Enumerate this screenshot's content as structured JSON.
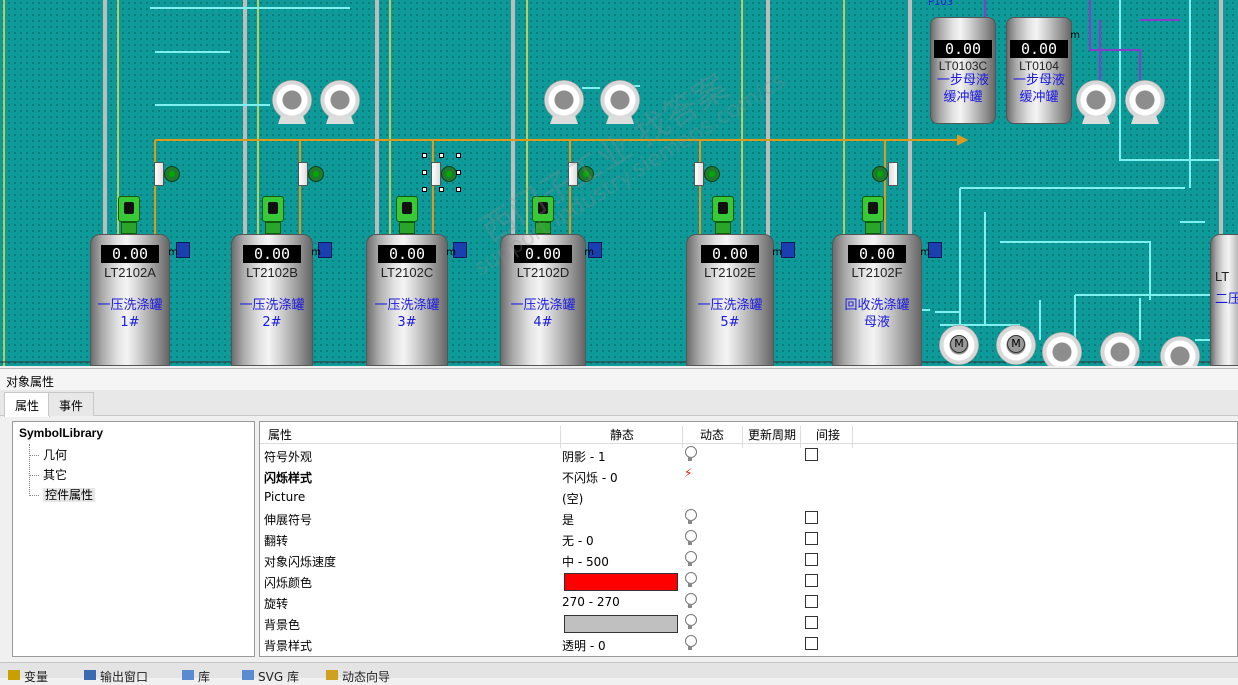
{
  "canvas": {
    "partial_label": "P103",
    "tanks": [
      {
        "value": "0.00",
        "unit": "m",
        "tag": "LT2102A",
        "desc": "一压洗涤罐\n1#"
      },
      {
        "value": "0.00",
        "unit": "m",
        "tag": "LT2102B",
        "desc": "一压洗涤罐\n2#"
      },
      {
        "value": "0.00",
        "unit": "m",
        "tag": "LT2102C",
        "desc": "一压洗涤罐\n3#"
      },
      {
        "value": "0.00",
        "unit": "m",
        "tag": "LT2102D",
        "desc": "一压洗涤罐\n4#"
      },
      {
        "value": "0.00",
        "unit": "m",
        "tag": "LT2102E",
        "desc": "一压洗涤罐\n5#"
      },
      {
        "value": "0.00",
        "unit": "m",
        "tag": "LT2102F",
        "desc": "回收洗涤罐\n母液"
      }
    ],
    "small_tanks": [
      {
        "value": "0.00",
        "unit": "m",
        "tag": "LT0103C",
        "desc": "一步母液\n缓冲罐"
      },
      {
        "value": "0.00",
        "unit": "m",
        "tag": "LT0104",
        "desc": "一步母液\n缓冲罐"
      }
    ],
    "edge_tank": {
      "tag": "LT",
      "desc": "二压"
    },
    "pump_motor_label": "M",
    "watermark": "西门子工业 找答案",
    "watermark_url": "support.industry.siemens.com/cs"
  },
  "panel": {
    "title": "对象属性",
    "tabs": [
      "属性",
      "事件"
    ],
    "tree": {
      "root": "SymbolLibrary",
      "nodes": [
        "几何",
        "其它",
        "控件属性"
      ],
      "selected": "控件属性"
    },
    "grid": {
      "headers": [
        "属性",
        "静态",
        "动态",
        "更新周期",
        "间接"
      ],
      "rows": [
        {
          "name": "符号外观",
          "static": "阴影 - 1",
          "dyn": "bulb",
          "indirect": true,
          "bold": false
        },
        {
          "name": "闪烁样式",
          "static": "不闪烁 - 0",
          "dyn": "bolt",
          "indirect": false,
          "bold": true
        },
        {
          "name": "Picture",
          "static": "(空)",
          "dyn": "",
          "indirect": false,
          "bold": false
        },
        {
          "name": "伸展符号",
          "static": "是",
          "dyn": "bulb",
          "indirect": true,
          "bold": false
        },
        {
          "name": "翻转",
          "static": "无 - 0",
          "dyn": "bulb",
          "indirect": true,
          "bold": false
        },
        {
          "name": "对象闪烁速度",
          "static": "中 - 500",
          "dyn": "bulb",
          "indirect": true,
          "bold": false
        },
        {
          "name": "闪烁颜色",
          "static": "",
          "swatch": "#ff0000",
          "dyn": "bulb",
          "indirect": true,
          "bold": false
        },
        {
          "name": "旋转",
          "static": "270 - 270",
          "dyn": "bulb",
          "indirect": true,
          "bold": false
        },
        {
          "name": "背景色",
          "static": "",
          "swatch": "#c0c0c0",
          "dyn": "bulb",
          "indirect": true,
          "bold": false
        },
        {
          "name": "背景样式",
          "static": "透明 - 0",
          "dyn": "bulb",
          "indirect": true,
          "bold": false
        }
      ]
    }
  },
  "bottom_tabs": [
    "变量",
    "输出窗口",
    "库",
    "SVG 库",
    "动态向导"
  ]
}
